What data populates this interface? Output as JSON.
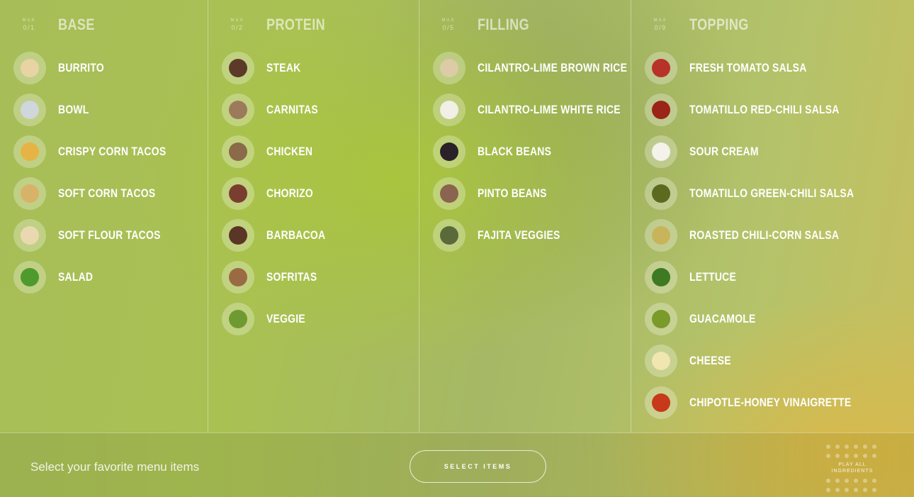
{
  "columns": [
    {
      "max_label": "MAX",
      "max_value": "0/1",
      "title": "BASE",
      "items": [
        {
          "label": "BURRITO",
          "icon": "tortilla-icon",
          "color": "#e8d3a4"
        },
        {
          "label": "BOWL",
          "icon": "bowl-icon",
          "color": "#cfd6dc"
        },
        {
          "label": "CRISPY CORN TACOS",
          "icon": "crispy-taco-icon",
          "color": "#e6b444"
        },
        {
          "label": "SOFT CORN TACOS",
          "icon": "soft-corn-taco-icon",
          "color": "#d9b26a"
        },
        {
          "label": "SOFT FLOUR TACOS",
          "icon": "soft-flour-taco-icon",
          "color": "#ead9b0"
        },
        {
          "label": "SALAD",
          "icon": "salad-icon",
          "color": "#4f9a2c"
        }
      ]
    },
    {
      "max_label": "MAX",
      "max_value": "0/2",
      "title": "PROTEIN",
      "items": [
        {
          "label": "STEAK",
          "icon": "steak-icon",
          "color": "#5c3a2a"
        },
        {
          "label": "CARNITAS",
          "icon": "carnitas-icon",
          "color": "#9c7a5c"
        },
        {
          "label": "CHICKEN",
          "icon": "chicken-icon",
          "color": "#8a6a48"
        },
        {
          "label": "CHORIZO",
          "icon": "chorizo-icon",
          "color": "#7a3e30"
        },
        {
          "label": "BARBACOA",
          "icon": "barbacoa-icon",
          "color": "#5a3626"
        },
        {
          "label": "SOFRITAS",
          "icon": "sofritas-icon",
          "color": "#9a6a44"
        },
        {
          "label": "VEGGIE",
          "icon": "veggie-icon",
          "color": "#6f9a32"
        }
      ]
    },
    {
      "max_label": "MAX",
      "max_value": "0/5",
      "title": "FILLING",
      "items": [
        {
          "label": "CILANTRO-LIME BROWN RICE",
          "icon": "brown-rice-icon",
          "color": "#dccba6"
        },
        {
          "label": "CILANTRO-LIME WHITE RICE",
          "icon": "white-rice-icon",
          "color": "#f1efe6"
        },
        {
          "label": "BLACK BEANS",
          "icon": "black-beans-icon",
          "color": "#2a2228"
        },
        {
          "label": "PINTO BEANS",
          "icon": "pinto-beans-icon",
          "color": "#8a6450"
        },
        {
          "label": "FAJITA VEGGIES",
          "icon": "fajita-veggies-icon",
          "color": "#5a6a3a"
        }
      ]
    },
    {
      "max_label": "MAX",
      "max_value": "0/9",
      "title": "TOPPING",
      "items": [
        {
          "label": "FRESH TOMATO SALSA",
          "icon": "tomato-salsa-icon",
          "color": "#b8322a"
        },
        {
          "label": "TOMATILLO RED-CHILI SALSA",
          "icon": "red-chili-salsa-icon",
          "color": "#9a2418"
        },
        {
          "label": "SOUR CREAM",
          "icon": "sour-cream-icon",
          "color": "#f4f2ea"
        },
        {
          "label": "TOMATILLO GREEN-CHILI SALSA",
          "icon": "green-chili-salsa-icon",
          "color": "#5a6a1e"
        },
        {
          "label": "ROASTED CHILI-CORN SALSA",
          "icon": "corn-salsa-icon",
          "color": "#c8b45a"
        },
        {
          "label": "LETTUCE",
          "icon": "lettuce-icon",
          "color": "#3e7a22"
        },
        {
          "label": "GUACAMOLE",
          "icon": "guacamole-icon",
          "color": "#7a9a2a"
        },
        {
          "label": "CHEESE",
          "icon": "cheese-icon",
          "color": "#efe6b0"
        },
        {
          "label": "CHIPOTLE-HONEY VINAIGRETTE",
          "icon": "vinaigrette-icon",
          "color": "#c8381a"
        }
      ]
    }
  ],
  "footer": {
    "prompt": "Select your favorite menu items",
    "select_button": "SELECT ITEMS",
    "play_all": "PLAY ALL INGREDIENTS"
  }
}
